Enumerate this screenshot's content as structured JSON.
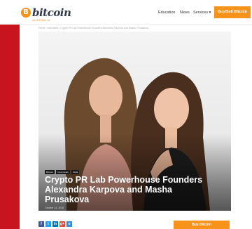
{
  "brand": {
    "coin_glyph": "B",
    "name": "bitcoin",
    "region": "AUSTRALIA",
    "accent": "#f7931a"
  },
  "nav": {
    "education": "Education",
    "news": "News",
    "services": "Services ▾",
    "buy_sell": "Buy/Sell Bitcoin"
  },
  "breadcrumb": "Home › Interviews › Crypto PR Lab Powerhouse Founders Alexandra Karpova and Masha Prusakova",
  "article": {
    "tags": [
      "Bitcoin",
      "Interviews",
      "Italia"
    ],
    "title": "Crypto PR Lab Powerhouse Founders Alexandra Karpova and Masha Prusakova",
    "date": "October 14, 2018"
  },
  "share": {
    "facebook": "f",
    "twitter": "t",
    "linkedin": "in",
    "google": "g+",
    "other": "o"
  },
  "cta": {
    "buy_bitcoin": "Buy Bitcoin"
  }
}
